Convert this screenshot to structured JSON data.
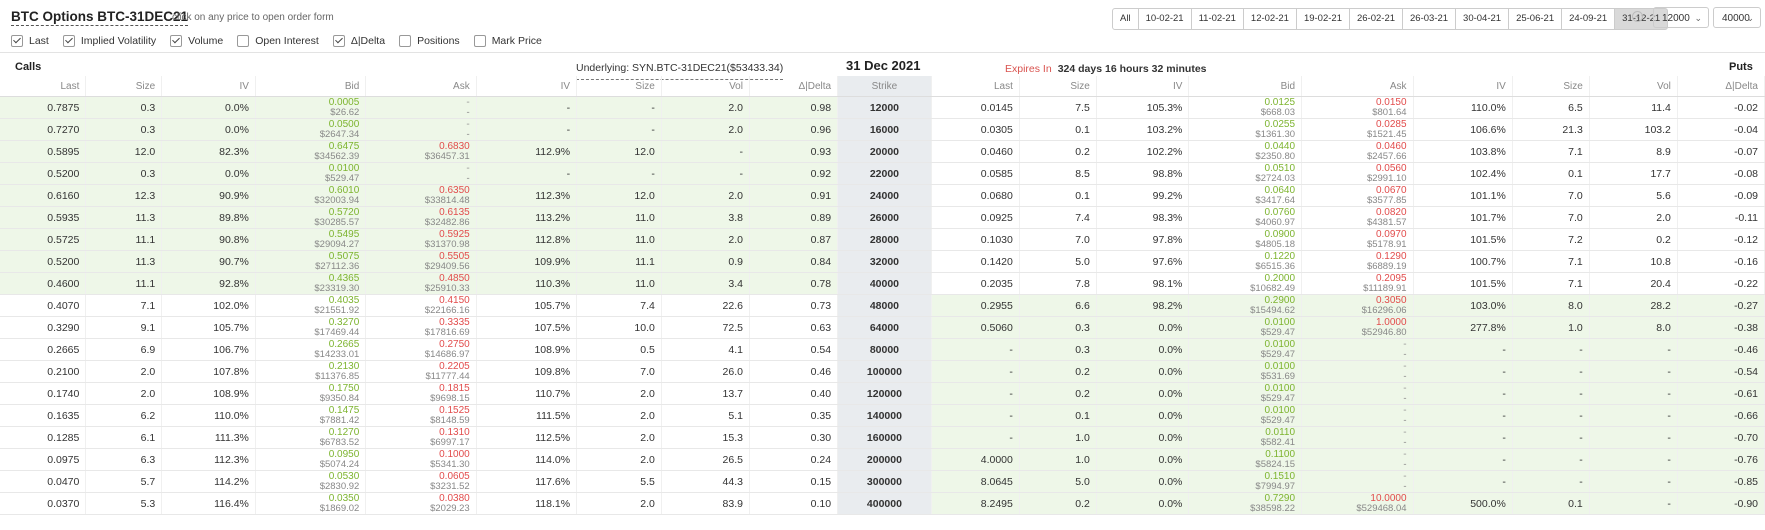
{
  "header": {
    "title": "BTC Options BTC-31DEC21",
    "hint": "click on any price to open order form"
  },
  "filters": [
    {
      "label": "Last",
      "checked": true
    },
    {
      "label": "Implied Volatility",
      "checked": true
    },
    {
      "label": "Volume",
      "checked": true
    },
    {
      "label": "Open Interest",
      "checked": false
    },
    {
      "label": "Δ|Delta",
      "checked": true
    },
    {
      "label": "Positions",
      "checked": false
    },
    {
      "label": "Mark Price",
      "checked": false
    }
  ],
  "expiry_tabs": [
    "All",
    "10-02-21",
    "11-02-21",
    "12-02-21",
    "19-02-21",
    "26-02-21",
    "26-03-21",
    "30-04-21",
    "25-06-21",
    "24-09-21",
    "31-12-21"
  ],
  "selected_expiry": "31-12-21",
  "strike_from": "12000",
  "strike_to": "40000",
  "section": {
    "calls": "Calls",
    "puts": "Puts",
    "underlying": "Underlying: SYN.BTC-31DEC21($53433.34)",
    "expiry_date": "31 Dec 2021",
    "expires_label": "Expires In",
    "expires_value": "324 days 16 hours 32 minutes"
  },
  "columns": {
    "calls": [
      "Last",
      "Size",
      "IV",
      "Bid",
      "Ask",
      "IV",
      "Size",
      "Vol",
      "Δ|Delta"
    ],
    "strike": "Strike",
    "puts": [
      "Last",
      "Size",
      "IV",
      "Bid",
      "Ask",
      "IV",
      "Size",
      "Vol",
      "Δ|Delta"
    ]
  },
  "rows": [
    {
      "strike": "12000",
      "itm_call": true,
      "itm_put": false,
      "c": {
        "last": "0.7875",
        "size": "0.3",
        "iv": "0.0%",
        "bid": [
          "0.0005",
          "$26.62"
        ],
        "ask": [
          "-",
          "-"
        ],
        "iv2": "-",
        "size2": "-",
        "vol": "2.0",
        "delta": "0.98"
      },
      "p": {
        "last": "0.0145",
        "size": "7.5",
        "iv": "105.3%",
        "bid": [
          "0.0125",
          "$668.03"
        ],
        "ask": [
          "0.0150",
          "$801.64"
        ],
        "iv2": "110.0%",
        "size2": "6.5",
        "vol": "11.4",
        "delta": "-0.02"
      }
    },
    {
      "strike": "16000",
      "itm_call": true,
      "itm_put": false,
      "c": {
        "last": "0.7270",
        "size": "0.3",
        "iv": "0.0%",
        "bid": [
          "0.0500",
          "$2647.34"
        ],
        "ask": [
          "-",
          "-"
        ],
        "iv2": "-",
        "size2": "-",
        "vol": "2.0",
        "delta": "0.96"
      },
      "p": {
        "last": "0.0305",
        "size": "0.1",
        "iv": "103.2%",
        "bid": [
          "0.0255",
          "$1361.30"
        ],
        "ask": [
          "0.0285",
          "$1521.45"
        ],
        "iv2": "106.6%",
        "size2": "21.3",
        "vol": "103.2",
        "delta": "-0.04"
      }
    },
    {
      "strike": "20000",
      "itm_call": true,
      "itm_put": false,
      "c": {
        "last": "0.5895",
        "size": "12.0",
        "iv": "82.3%",
        "bid": [
          "0.6475",
          "$34562.39"
        ],
        "ask": [
          "0.6830",
          "$36457.31"
        ],
        "iv2": "112.9%",
        "size2": "12.0",
        "vol": "-",
        "delta": "0.93"
      },
      "p": {
        "last": "0.0460",
        "size": "0.2",
        "iv": "102.2%",
        "bid": [
          "0.0440",
          "$2350.80"
        ],
        "ask": [
          "0.0460",
          "$2457.66"
        ],
        "iv2": "103.8%",
        "size2": "7.1",
        "vol": "8.9",
        "delta": "-0.07"
      }
    },
    {
      "strike": "22000",
      "itm_call": true,
      "itm_put": false,
      "c": {
        "last": "0.5200",
        "size": "0.3",
        "iv": "0.0%",
        "bid": [
          "0.0100",
          "$529.47"
        ],
        "ask": [
          "-",
          "-"
        ],
        "iv2": "-",
        "size2": "-",
        "vol": "-",
        "delta": "0.92"
      },
      "p": {
        "last": "0.0585",
        "size": "8.5",
        "iv": "98.8%",
        "bid": [
          "0.0510",
          "$2724.03"
        ],
        "ask": [
          "0.0560",
          "$2991.10"
        ],
        "iv2": "102.4%",
        "size2": "0.1",
        "vol": "17.7",
        "delta": "-0.08"
      }
    },
    {
      "strike": "24000",
      "itm_call": true,
      "itm_put": false,
      "c": {
        "last": "0.6160",
        "size": "12.3",
        "iv": "90.9%",
        "bid": [
          "0.6010",
          "$32003.94"
        ],
        "ask": [
          "0.6350",
          "$33814.48"
        ],
        "iv2": "112.3%",
        "size2": "12.0",
        "vol": "2.0",
        "delta": "0.91"
      },
      "p": {
        "last": "0.0680",
        "size": "0.1",
        "iv": "99.2%",
        "bid": [
          "0.0640",
          "$3417.64"
        ],
        "ask": [
          "0.0670",
          "$3577.85"
        ],
        "iv2": "101.1%",
        "size2": "7.0",
        "vol": "5.6",
        "delta": "-0.09"
      }
    },
    {
      "strike": "26000",
      "itm_call": true,
      "itm_put": false,
      "c": {
        "last": "0.5935",
        "size": "11.3",
        "iv": "89.8%",
        "bid": [
          "0.5720",
          "$30285.57"
        ],
        "ask": [
          "0.6135",
          "$32482.86"
        ],
        "iv2": "113.2%",
        "size2": "11.0",
        "vol": "3.8",
        "delta": "0.89"
      },
      "p": {
        "last": "0.0925",
        "size": "7.4",
        "iv": "98.3%",
        "bid": [
          "0.0760",
          "$4060.97"
        ],
        "ask": [
          "0.0820",
          "$4381.57"
        ],
        "iv2": "101.7%",
        "size2": "7.0",
        "vol": "2.0",
        "delta": "-0.11"
      }
    },
    {
      "strike": "28000",
      "itm_call": true,
      "itm_put": false,
      "c": {
        "last": "0.5725",
        "size": "11.1",
        "iv": "90.8%",
        "bid": [
          "0.5495",
          "$29094.27"
        ],
        "ask": [
          "0.5925",
          "$31370.98"
        ],
        "iv2": "112.8%",
        "size2": "11.0",
        "vol": "2.0",
        "delta": "0.87"
      },
      "p": {
        "last": "0.1030",
        "size": "7.0",
        "iv": "97.8%",
        "bid": [
          "0.0900",
          "$4805.18"
        ],
        "ask": [
          "0.0970",
          "$5178.91"
        ],
        "iv2": "101.5%",
        "size2": "7.2",
        "vol": "0.2",
        "delta": "-0.12"
      }
    },
    {
      "strike": "32000",
      "itm_call": true,
      "itm_put": false,
      "c": {
        "last": "0.5200",
        "size": "11.3",
        "iv": "90.7%",
        "bid": [
          "0.5075",
          "$27112.36"
        ],
        "ask": [
          "0.5505",
          "$29409.56"
        ],
        "iv2": "109.9%",
        "size2": "11.1",
        "vol": "0.9",
        "delta": "0.84"
      },
      "p": {
        "last": "0.1420",
        "size": "5.0",
        "iv": "97.6%",
        "bid": [
          "0.1220",
          "$6515.36"
        ],
        "ask": [
          "0.1290",
          "$6889.19"
        ],
        "iv2": "100.7%",
        "size2": "7.1",
        "vol": "10.8",
        "delta": "-0.16"
      }
    },
    {
      "strike": "40000",
      "itm_call": true,
      "itm_put": false,
      "c": {
        "last": "0.4600",
        "size": "11.1",
        "iv": "92.8%",
        "bid": [
          "0.4365",
          "$23319.30"
        ],
        "ask": [
          "0.4850",
          "$25910.33"
        ],
        "iv2": "110.3%",
        "size2": "11.0",
        "vol": "3.4",
        "delta": "0.78"
      },
      "p": {
        "last": "0.2035",
        "size": "7.8",
        "iv": "98.1%",
        "bid": [
          "0.2000",
          "$10682.49"
        ],
        "ask": [
          "0.2095",
          "$11189.91"
        ],
        "iv2": "101.5%",
        "size2": "7.1",
        "vol": "20.4",
        "delta": "-0.22"
      }
    },
    {
      "strike": "48000",
      "itm_call": false,
      "itm_put": true,
      "c": {
        "last": "0.4070",
        "size": "7.1",
        "iv": "102.0%",
        "bid": [
          "0.4035",
          "$21551.92"
        ],
        "ask": [
          "0.4150",
          "$22166.16"
        ],
        "iv2": "105.7%",
        "size2": "7.4",
        "vol": "22.6",
        "delta": "0.73"
      },
      "p": {
        "last": "0.2955",
        "size": "6.6",
        "iv": "98.2%",
        "bid": [
          "0.2900",
          "$15494.62"
        ],
        "ask": [
          "0.3050",
          "$16296.06"
        ],
        "iv2": "103.0%",
        "size2": "8.0",
        "vol": "28.2",
        "delta": "-0.27"
      }
    },
    {
      "strike": "64000",
      "itm_call": false,
      "itm_put": true,
      "c": {
        "last": "0.3290",
        "size": "9.1",
        "iv": "105.7%",
        "bid": [
          "0.3270",
          "$17469.44"
        ],
        "ask": [
          "0.3335",
          "$17816.69"
        ],
        "iv2": "107.5%",
        "size2": "10.0",
        "vol": "72.5",
        "delta": "0.63"
      },
      "p": {
        "last": "0.5060",
        "size": "0.3",
        "iv": "0.0%",
        "bid": [
          "0.0100",
          "$529.47"
        ],
        "ask": [
          "1.0000",
          "$52946.80"
        ],
        "iv2": "277.8%",
        "size2": "1.0",
        "vol": "8.0",
        "delta": "-0.38"
      }
    },
    {
      "strike": "80000",
      "itm_call": false,
      "itm_put": true,
      "c": {
        "last": "0.2665",
        "size": "6.9",
        "iv": "106.7%",
        "bid": [
          "0.2665",
          "$14233.01"
        ],
        "ask": [
          "0.2750",
          "$14686.97"
        ],
        "iv2": "108.9%",
        "size2": "0.5",
        "vol": "4.1",
        "delta": "0.54"
      },
      "p": {
        "last": "-",
        "size": "0.3",
        "iv": "0.0%",
        "bid": [
          "0.0100",
          "$529.47"
        ],
        "ask": [
          "-",
          "-"
        ],
        "iv2": "-",
        "size2": "-",
        "vol": "-",
        "delta": "-0.46"
      }
    },
    {
      "strike": "100000",
      "itm_call": false,
      "itm_put": true,
      "c": {
        "last": "0.2100",
        "size": "2.0",
        "iv": "107.8%",
        "bid": [
          "0.2130",
          "$11376.85"
        ],
        "ask": [
          "0.2205",
          "$11777.44"
        ],
        "iv2": "109.8%",
        "size2": "7.0",
        "vol": "26.0",
        "delta": "0.46"
      },
      "p": {
        "last": "-",
        "size": "0.2",
        "iv": "0.0%",
        "bid": [
          "0.0100",
          "$531.69"
        ],
        "ask": [
          "-",
          "-"
        ],
        "iv2": "-",
        "size2": "-",
        "vol": "-",
        "delta": "-0.54"
      }
    },
    {
      "strike": "120000",
      "itm_call": false,
      "itm_put": true,
      "c": {
        "last": "0.1740",
        "size": "2.0",
        "iv": "108.9%",
        "bid": [
          "0.1750",
          "$9350.84"
        ],
        "ask": [
          "0.1815",
          "$9698.15"
        ],
        "iv2": "110.7%",
        "size2": "2.0",
        "vol": "13.7",
        "delta": "0.40"
      },
      "p": {
        "last": "-",
        "size": "0.2",
        "iv": "0.0%",
        "bid": [
          "0.0100",
          "$529.47"
        ],
        "ask": [
          "-",
          "-"
        ],
        "iv2": "-",
        "size2": "-",
        "vol": "-",
        "delta": "-0.61"
      }
    },
    {
      "strike": "140000",
      "itm_call": false,
      "itm_put": true,
      "c": {
        "last": "0.1635",
        "size": "6.2",
        "iv": "110.0%",
        "bid": [
          "0.1475",
          "$7881.42"
        ],
        "ask": [
          "0.1525",
          "$8148.59"
        ],
        "iv2": "111.5%",
        "size2": "2.0",
        "vol": "5.1",
        "delta": "0.35"
      },
      "p": {
        "last": "-",
        "size": "0.1",
        "iv": "0.0%",
        "bid": [
          "0.0100",
          "$529.47"
        ],
        "ask": [
          "-",
          "-"
        ],
        "iv2": "-",
        "size2": "-",
        "vol": "-",
        "delta": "-0.66"
      }
    },
    {
      "strike": "160000",
      "itm_call": false,
      "itm_put": true,
      "c": {
        "last": "0.1285",
        "size": "6.1",
        "iv": "111.3%",
        "bid": [
          "0.1270",
          "$6783.52"
        ],
        "ask": [
          "0.1310",
          "$6997.17"
        ],
        "iv2": "112.5%",
        "size2": "2.0",
        "vol": "15.3",
        "delta": "0.30"
      },
      "p": {
        "last": "-",
        "size": "1.0",
        "iv": "0.0%",
        "bid": [
          "0.0110",
          "$582.41"
        ],
        "ask": [
          "-",
          "-"
        ],
        "iv2": "-",
        "size2": "-",
        "vol": "-",
        "delta": "-0.70"
      }
    },
    {
      "strike": "200000",
      "itm_call": false,
      "itm_put": true,
      "c": {
        "last": "0.0975",
        "size": "6.3",
        "iv": "112.3%",
        "bid": [
          "0.0950",
          "$5074.24"
        ],
        "ask": [
          "0.1000",
          "$5341.30"
        ],
        "iv2": "114.0%",
        "size2": "2.0",
        "vol": "26.5",
        "delta": "0.24"
      },
      "p": {
        "last": "4.0000",
        "size": "1.0",
        "iv": "0.0%",
        "bid": [
          "0.1100",
          "$5824.15"
        ],
        "ask": [
          "-",
          "-"
        ],
        "iv2": "-",
        "size2": "-",
        "vol": "-",
        "delta": "-0.76"
      }
    },
    {
      "strike": "300000",
      "itm_call": false,
      "itm_put": true,
      "c": {
        "last": "0.0470",
        "size": "5.7",
        "iv": "114.2%",
        "bid": [
          "0.0530",
          "$2830.92"
        ],
        "ask": [
          "0.0605",
          "$3231.52"
        ],
        "iv2": "117.6%",
        "size2": "5.5",
        "vol": "44.3",
        "delta": "0.15"
      },
      "p": {
        "last": "8.0645",
        "size": "5.0",
        "iv": "0.0%",
        "bid": [
          "0.1510",
          "$7994.97"
        ],
        "ask": [
          "-",
          "-"
        ],
        "iv2": "-",
        "size2": "-",
        "vol": "-",
        "delta": "-0.85"
      }
    },
    {
      "strike": "400000",
      "itm_call": false,
      "itm_put": true,
      "c": {
        "last": "0.0370",
        "size": "5.3",
        "iv": "116.4%",
        "bid": [
          "0.0350",
          "$1869.02"
        ],
        "ask": [
          "0.0380",
          "$2029.23"
        ],
        "iv2": "118.1%",
        "size2": "2.0",
        "vol": "83.9",
        "delta": "0.10"
      },
      "p": {
        "last": "8.2495",
        "size": "0.2",
        "iv": "0.0%",
        "bid": [
          "0.7290",
          "$38598.22"
        ],
        "ask": [
          "10.0000",
          "$529468.04"
        ],
        "iv2": "500.0%",
        "size2": "0.1",
        "vol": "-",
        "delta": "-0.90"
      }
    }
  ]
}
